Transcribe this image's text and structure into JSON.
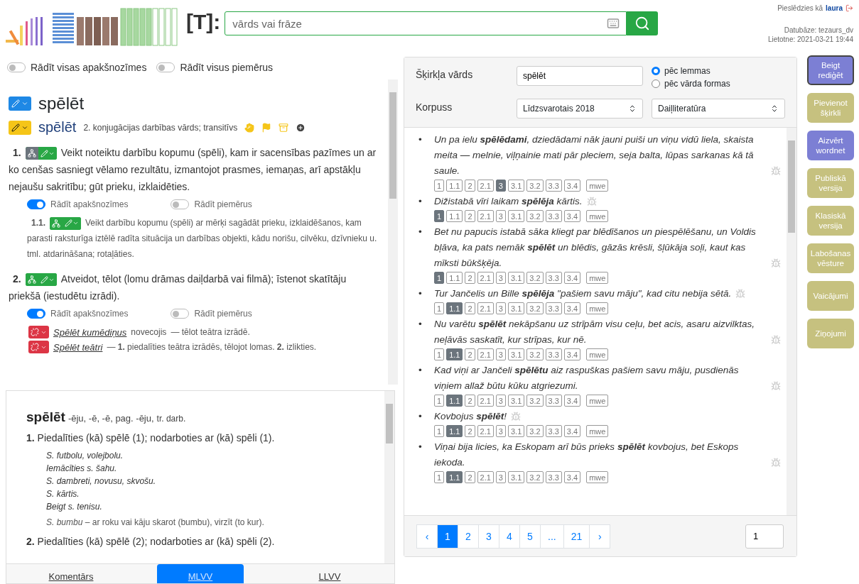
{
  "header": {
    "logo_text": "[T]:",
    "search": {
      "placeholder": "vārds vai frāze"
    },
    "login_label": "Pieslēdzies kā",
    "user": "laura",
    "database": "Datubāze: tezaurs_dv",
    "app_version": "Lietotne: 2021-03-21 19:44"
  },
  "left": {
    "toggles": [
      {
        "label": "Rādīt visas apakšnozīmes",
        "on": false
      },
      {
        "label": "Rādīt visus piemērus",
        "on": false
      }
    ],
    "entry": {
      "headword": "spēlēt",
      "lexeme": {
        "word": "spēlēt",
        "grammar": "2. konjugācijas darbības vārds; transitīvs"
      },
      "senses": [
        {
          "number": "1.",
          "color": "#6c757d",
          "text": "Veikt noteiktu darbību kopumu (spēli), kam ir sacensības pazīmes un ar ko cenšas sasniegt vēlamo rezultātu, izmantojot prasmes, iemaņas, arī apstākļu nejaušu sakritību; gūt prieku, izklaidēties.",
          "toggles": [
            {
              "label": "Rādīt apakšnozīmes",
              "on": true
            },
            {
              "label": "Rādīt piemērus",
              "on": false
            }
          ],
          "children": [
            {
              "number": "1.1.",
              "color": "#28a745",
              "text": "Veikt darbību kopumu (spēli) ar mērķi sagādāt prieku, izklaidēšanos, kam parasti raksturīga iztēlē radīta situācija un darbības objekti, kādu norišu, cilvēku, dzīvnieku u. tml. atdarināšana; rotaļāties."
            }
          ]
        },
        {
          "number": "2.",
          "color": "#28a745",
          "text": "Atveidot, tēlot (lomu drāmas daiļdarbā vai filmā); īstenot skatītāju priekšā (iestudētu izrādi).",
          "toggles": [
            {
              "label": "Rādīt apakšnozīmes",
              "on": true
            },
            {
              "label": "Rādīt piemērus",
              "on": false
            }
          ],
          "phrases": [
            {
              "phrase": "Spēlēt kumēdiņus",
              "note": "novecojis",
              "text": "— tēlot teātra izrādē."
            },
            {
              "phrase": "Spēlēt teātri",
              "text": "—  **1.** piedalīties teātra izrādēs, tēlojot lomas.  **2.** izlikties."
            }
          ]
        }
      ]
    },
    "dictionary": {
      "headword": "spēlēt",
      "forms": "-ēju, -ē, -ē, pag. -ēju,",
      "grammar": "tr. darb.",
      "senses": [
        {
          "number": "1.",
          "text": "Piedalīties (kā) spēlē (1); nodarboties ar (kā) spēli (1).",
          "examples": [
            "S. futbolu, volejbolu.",
            "Iemācīties s. šahu.",
            "S. dambreti, novusu, skvošu.",
            "S. kārtis.",
            "Beigt s. tenisu."
          ],
          "phrases": [
            {
              "phrase": "S. bumbu",
              "text": "– ar roku vai kāju skarot (bumbu), virzīt (to kur)."
            }
          ]
        },
        {
          "number": "2.",
          "text": "Piedalīties (kā) spēlē (2); nodarboties ar (kā) spēli (2)."
        }
      ]
    },
    "tabs": [
      {
        "label": "Komentārs",
        "selected": false
      },
      {
        "label": "MLVV",
        "selected": true
      },
      {
        "label": "LLVV",
        "selected": false
      }
    ]
  },
  "corpus": {
    "lemma_label": "Šķirkļa vārds",
    "lemma_value": "spēlēt",
    "modes": [
      {
        "label": "pēc lemmas",
        "selected": true
      },
      {
        "label": "pēc vārda formas",
        "selected": false
      }
    ],
    "corpus_label": "Korpuss",
    "corpus_value": "Līdzsvarotais 2018",
    "genre_value": "Daiļliteratūra",
    "examples": [
      {
        "text": "Un pa ielu **spēlēdami**, dziedādami nāk jauni puiši un viņu vidū liela, skaista meita — melnie, viļņainie mati pār pleciem, seja balta, lūpas sarkanas kā tā saule.",
        "tags": [
          {
            "label": "1",
            "selected": false
          },
          {
            "label": "1.1",
            "selected": false
          },
          {
            "label": "2",
            "selected": false
          },
          {
            "label": "2.1",
            "selected": false
          },
          {
            "label": "3",
            "selected": true
          },
          {
            "label": "3.1",
            "selected": false
          },
          {
            "label": "3.2",
            "selected": false
          },
          {
            "label": "3.3",
            "selected": false
          },
          {
            "label": "3.4",
            "selected": false
          },
          {
            "label": "mwe",
            "selected": false
          }
        ]
      },
      {
        "text": "Dižistabā vīri laikam **spēlēja** kārtis.",
        "tags": [
          {
            "label": "1",
            "selected": true
          },
          {
            "label": "1.1",
            "selected": false
          },
          {
            "label": "2",
            "selected": false
          },
          {
            "label": "2.1",
            "selected": false
          },
          {
            "label": "3",
            "selected": false
          },
          {
            "label": "3.1",
            "selected": false
          },
          {
            "label": "3.2",
            "selected": false
          },
          {
            "label": "3.3",
            "selected": false
          },
          {
            "label": "3.4",
            "selected": false
          },
          {
            "label": "mwe",
            "selected": false
          }
        ]
      },
      {
        "text": "Bet nu papucis istabā sāka kliegt par blēdīšanos un piespēlēšanu, un Voldis bļāva, ka pats nemāk **spēlēt** un blēdis, gāzās krēsli, šļūkāja soļi, kaut kas mīksti būkšķēja.",
        "tags": [
          {
            "label": "1",
            "selected": true
          },
          {
            "label": "1.1",
            "selected": false
          },
          {
            "label": "2",
            "selected": false
          },
          {
            "label": "2.1",
            "selected": false
          },
          {
            "label": "3",
            "selected": false
          },
          {
            "label": "3.1",
            "selected": false
          },
          {
            "label": "3.2",
            "selected": false
          },
          {
            "label": "3.3",
            "selected": false
          },
          {
            "label": "3.4",
            "selected": false
          },
          {
            "label": "mwe",
            "selected": false
          }
        ]
      },
      {
        "text": "Tur Jančelis un Bille **spēlēja** \"pašiem savu māju\", kad citu nebija sētā.",
        "tags": [
          {
            "label": "1",
            "selected": false
          },
          {
            "label": "1.1",
            "selected": true
          },
          {
            "label": "2",
            "selected": false
          },
          {
            "label": "2.1",
            "selected": false
          },
          {
            "label": "3",
            "selected": false
          },
          {
            "label": "3.1",
            "selected": false
          },
          {
            "label": "3.2",
            "selected": false
          },
          {
            "label": "3.3",
            "selected": false
          },
          {
            "label": "3.4",
            "selected": false
          },
          {
            "label": "mwe",
            "selected": false
          }
        ]
      },
      {
        "text": "Nu varētu **spēlēt** nekāpšanu uz strīpām visu ceļu, bet acis, asaru aizvilktas, neļāvās saskatīt, kur strīpas, kur nē.",
        "tags": [
          {
            "label": "1",
            "selected": false
          },
          {
            "label": "1.1",
            "selected": true
          },
          {
            "label": "2",
            "selected": false
          },
          {
            "label": "2.1",
            "selected": false
          },
          {
            "label": "3",
            "selected": false
          },
          {
            "label": "3.1",
            "selected": false
          },
          {
            "label": "3.2",
            "selected": false
          },
          {
            "label": "3.3",
            "selected": false
          },
          {
            "label": "3.4",
            "selected": false
          },
          {
            "label": "mwe",
            "selected": false
          }
        ]
      },
      {
        "text": "Kad viņi ar Jančeli **spēlētu** aiz raspuškas pašiem savu māju, pusdienās viņiem allaž būtu kūku atgriezumi.",
        "tags": [
          {
            "label": "1",
            "selected": false
          },
          {
            "label": "1.1",
            "selected": true
          },
          {
            "label": "2",
            "selected": false
          },
          {
            "label": "2.1",
            "selected": false
          },
          {
            "label": "3",
            "selected": false
          },
          {
            "label": "3.1",
            "selected": false
          },
          {
            "label": "3.2",
            "selected": false
          },
          {
            "label": "3.3",
            "selected": false
          },
          {
            "label": "3.4",
            "selected": false
          },
          {
            "label": "mwe",
            "selected": false
          }
        ]
      },
      {
        "text": "Kovbojus **spēlēt**!",
        "tags": [
          {
            "label": "1",
            "selected": false
          },
          {
            "label": "1.1",
            "selected": true
          },
          {
            "label": "2",
            "selected": false
          },
          {
            "label": "2.1",
            "selected": false
          },
          {
            "label": "3",
            "selected": false
          },
          {
            "label": "3.1",
            "selected": false
          },
          {
            "label": "3.2",
            "selected": false
          },
          {
            "label": "3.3",
            "selected": false
          },
          {
            "label": "3.4",
            "selected": false
          },
          {
            "label": "mwe",
            "selected": false
          }
        ]
      },
      {
        "text": "Viņai bija licies, ka Eskopam arī būs prieks **spēlēt** kovbojus, bet Eskops iekoda.",
        "tags": [
          {
            "label": "1",
            "selected": false
          },
          {
            "label": "1.1",
            "selected": true
          },
          {
            "label": "2",
            "selected": false
          },
          {
            "label": "2.1",
            "selected": false
          },
          {
            "label": "3",
            "selected": false
          },
          {
            "label": "3.1",
            "selected": false
          },
          {
            "label": "3.2",
            "selected": false
          },
          {
            "label": "3.3",
            "selected": false
          },
          {
            "label": "3.4",
            "selected": false
          },
          {
            "label": "mwe",
            "selected": false
          }
        ]
      }
    ],
    "pagination": [
      {
        "label": "‹",
        "selected": false
      },
      {
        "label": "1",
        "selected": true
      },
      {
        "label": "2",
        "selected": false
      },
      {
        "label": "3",
        "selected": false
      },
      {
        "label": "4",
        "selected": false
      },
      {
        "label": "5",
        "selected": false
      },
      {
        "label": "...",
        "selected": false
      },
      {
        "label": "21",
        "selected": false
      },
      {
        "label": "›",
        "selected": false
      }
    ],
    "page_input": "1",
    "marker": "•"
  },
  "actions": [
    {
      "label": "Beigt rediģēt",
      "color": "#7c7fd4",
      "focused": true
    },
    {
      "label": "Pievienot šķirkli",
      "color": "#c6c17f",
      "focused": false
    },
    {
      "label": "Aizvērt wordnet",
      "color": "#7c7fd4",
      "focused": false
    },
    {
      "label": "Publiskā versija",
      "color": "#c6c17f",
      "focused": false
    },
    {
      "label": "Klasiskā versija",
      "color": "#c6c17f",
      "focused": false
    },
    {
      "label": "Labošanas vēsture",
      "color": "#c6c17f",
      "focused": false
    },
    {
      "label": "Vaicājumi",
      "color": "#c6c17f",
      "focused": false
    },
    {
      "label": "Ziņojumi",
      "color": "#c6c17f",
      "focused": false
    }
  ]
}
